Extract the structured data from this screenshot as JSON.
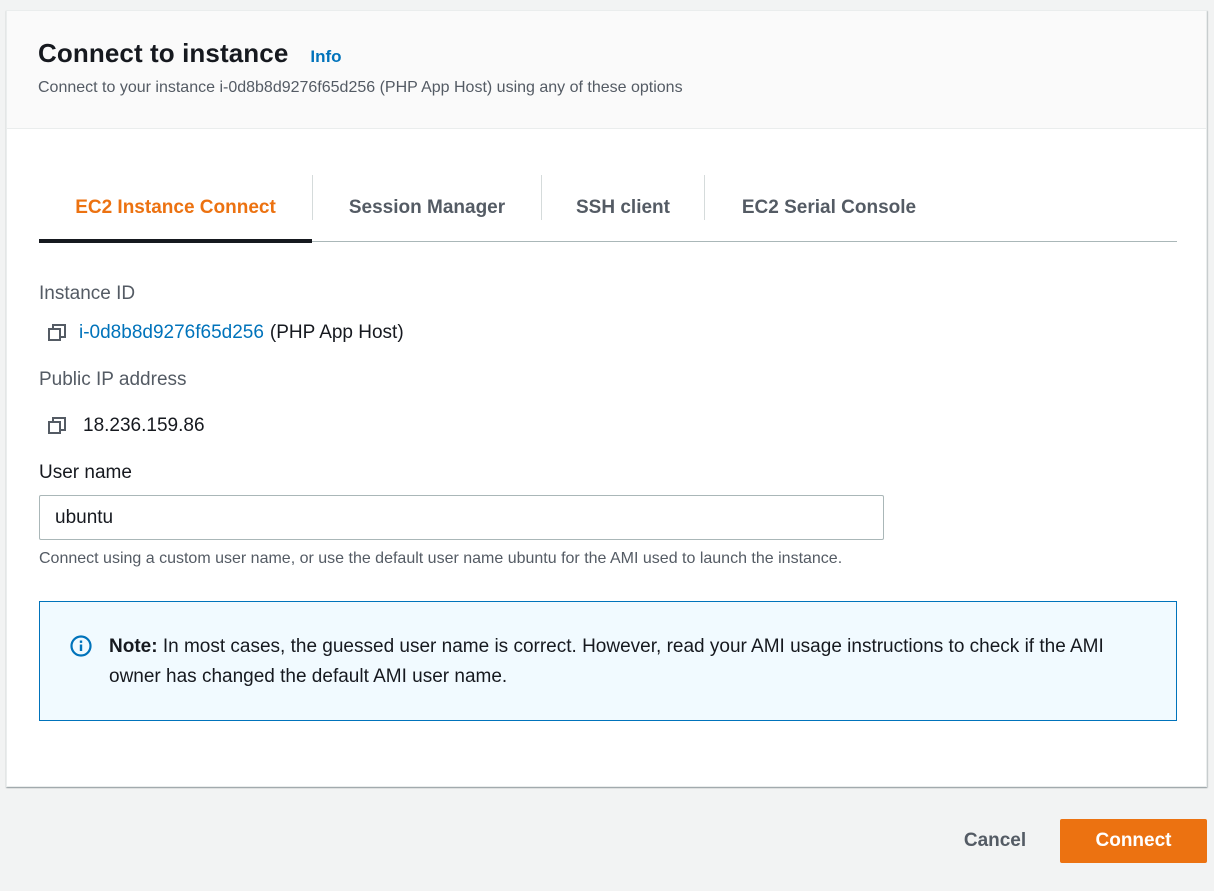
{
  "header": {
    "title": "Connect to instance",
    "info_label": "Info",
    "subtitle": "Connect to your instance i-0d8b8d9276f65d256 (PHP App Host) using any of these options"
  },
  "tabs": [
    {
      "label": "EC2 Instance Connect",
      "active": true
    },
    {
      "label": "Session Manager",
      "active": false
    },
    {
      "label": "SSH client",
      "active": false
    },
    {
      "label": "EC2 Serial Console",
      "active": false
    }
  ],
  "instance": {
    "label": "Instance ID",
    "id": "i-0d8b8d9276f65d256",
    "name_suffix": "(PHP App Host)"
  },
  "public_ip": {
    "label": "Public IP address",
    "value": "18.236.159.86"
  },
  "username": {
    "label": "User name",
    "value": "ubuntu",
    "hint": "Connect using a custom user name, or use the default user name ubuntu for the AMI used to launch the instance."
  },
  "note": {
    "prefix": "Note:",
    "text": " In most cases, the guessed user name is correct. However, read your AMI usage instructions to check if the AMI owner has changed the default AMI user name."
  },
  "footer": {
    "cancel_label": "Cancel",
    "connect_label": "Connect"
  },
  "colors": {
    "accent": "#ec7211",
    "link": "#0073bb",
    "alert_bg": "#f1faff"
  },
  "icons": {
    "copy": "copy-icon",
    "info": "info-circle-icon"
  }
}
